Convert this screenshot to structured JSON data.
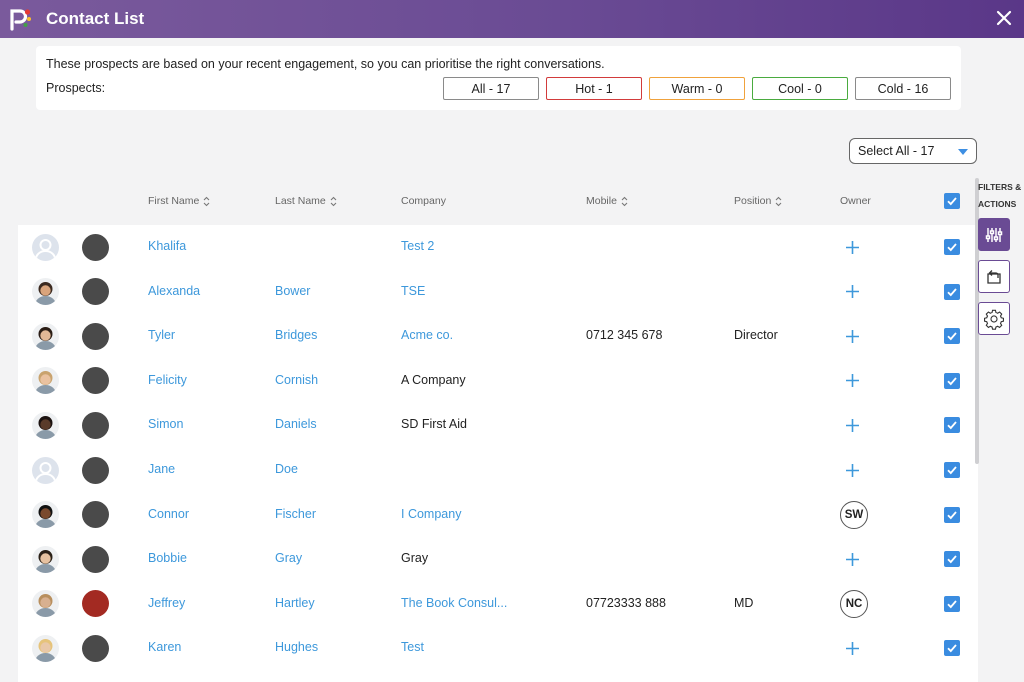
{
  "window": {
    "title": "Contact List"
  },
  "info": {
    "text": "These prospects are based on your recent engagement, so you can prioritise the right conversations.",
    "prospects_label": "Prospects:"
  },
  "filters": [
    {
      "label": "All - 17",
      "color": "#8a8a8a"
    },
    {
      "label": "Hot - 1",
      "color": "#d23b3b"
    },
    {
      "label": "Warm - 0",
      "color": "#f0a23c"
    },
    {
      "label": "Cool - 0",
      "color": "#4aab3f"
    },
    {
      "label": "Cold - 16",
      "color": "#8a8a8a"
    }
  ],
  "select_all": {
    "label": "Select All - 17"
  },
  "columns": {
    "first_name": "First Name",
    "last_name": "Last Name",
    "company": "Company",
    "mobile": "Mobile",
    "position": "Position",
    "owner": "Owner"
  },
  "side_panel": {
    "label": "FILTERS & ACTIONS"
  },
  "colors": {
    "accent": "#6a4b94",
    "link": "#3d98db",
    "checkbox": "#3a8ce0"
  },
  "rows": [
    {
      "first": "Khalifa",
      "last": "",
      "company": "Test 2",
      "company_link": true,
      "mobile": "",
      "position": "",
      "owner": "",
      "status_color": "#4a4a4a",
      "avatar": "placeholder"
    },
    {
      "first": "Alexanda",
      "last": "Bower",
      "company": "TSE",
      "company_link": true,
      "mobile": "",
      "position": "",
      "owner": "",
      "status_color": "#4a4a4a",
      "avatar": "photo"
    },
    {
      "first": "Tyler",
      "last": "Bridges",
      "company": "Acme co.",
      "company_link": true,
      "mobile": "0712 345 678",
      "position": "Director",
      "owner": "",
      "status_color": "#4a4a4a",
      "avatar": "photo"
    },
    {
      "first": "Felicity",
      "last": "Cornish",
      "company": "A Company",
      "company_link": false,
      "mobile": "",
      "position": "",
      "owner": "",
      "status_color": "#4a4a4a",
      "avatar": "photo"
    },
    {
      "first": "Simon",
      "last": "Daniels",
      "company": "SD First Aid",
      "company_link": false,
      "mobile": "",
      "position": "",
      "owner": "",
      "status_color": "#4a4a4a",
      "avatar": "photo"
    },
    {
      "first": "Jane",
      "last": "Doe",
      "company": "",
      "company_link": false,
      "mobile": "",
      "position": "",
      "owner": "",
      "status_color": "#4a4a4a",
      "avatar": "placeholder"
    },
    {
      "first": "Connor",
      "last": "Fischer",
      "company": "I Company",
      "company_link": true,
      "mobile": "",
      "position": "",
      "owner": "SW",
      "status_color": "#4a4a4a",
      "avatar": "photo"
    },
    {
      "first": "Bobbie",
      "last": "Gray",
      "company": "Gray",
      "company_link": false,
      "mobile": "",
      "position": "",
      "owner": "",
      "status_color": "#4a4a4a",
      "avatar": "photo"
    },
    {
      "first": "Jeffrey",
      "last": "Hartley",
      "company": "The Book Consul...",
      "company_link": true,
      "mobile": "07723333 888",
      "position": "MD",
      "owner": "NC",
      "status_color": "#a32a22",
      "avatar": "photo"
    },
    {
      "first": "Karen",
      "last": "Hughes",
      "company": "Test",
      "company_link": true,
      "mobile": "",
      "position": "",
      "owner": "",
      "status_color": "#4a4a4a",
      "avatar": "photo"
    }
  ]
}
